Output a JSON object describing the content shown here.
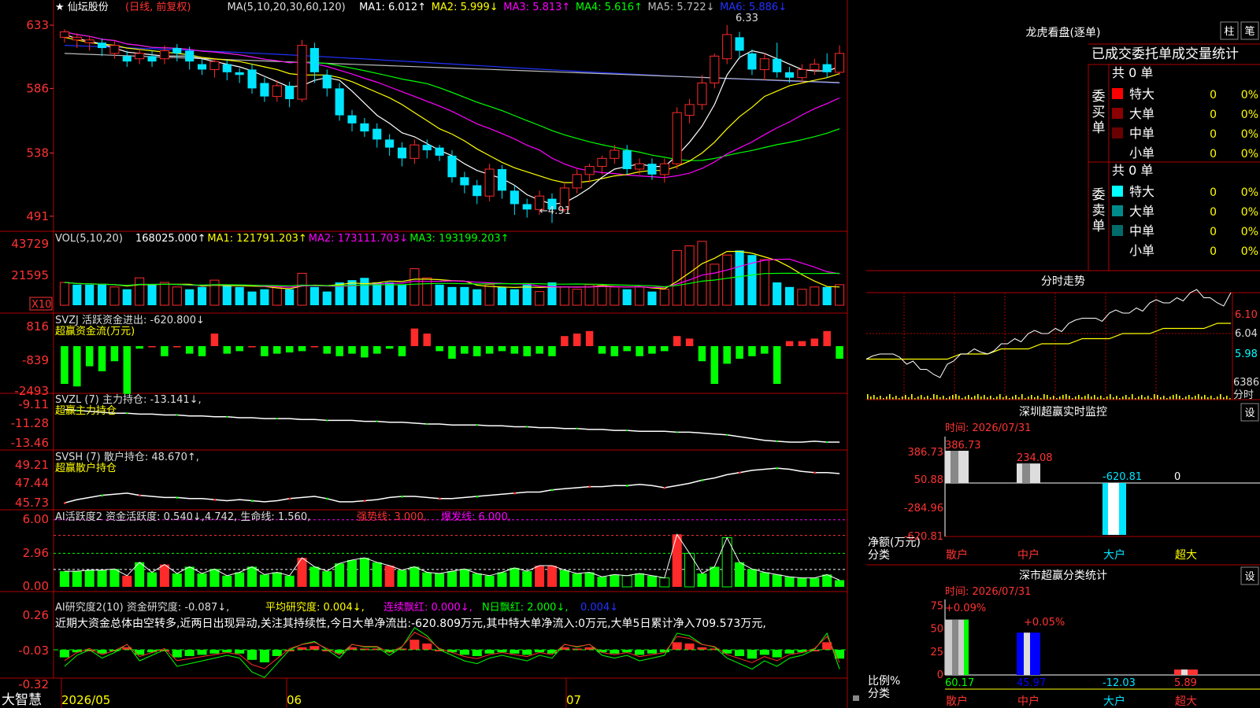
{
  "colors": {
    "up": "#ff2a2a",
    "down": "#00e5ff",
    "grid": "#b00000",
    "ma1": "#ffffff",
    "ma2": "#ffff00",
    "ma3": "#ff00ff",
    "ma4": "#00ff00",
    "ma5": "#bbbbbb",
    "ma6": "#2233ff",
    "green": "#00ff00",
    "yellow": "#ffff00",
    "magenta": "#ff00ff",
    "white": "#ffffff"
  },
  "header": {
    "title": "★ 仙坛股份",
    "mode": "(日线, 前复权)",
    "ma_name": "MA(5,10,20,30,60,120)",
    "ma1": "MA1: 6.012↑",
    "ma2": "MA2: 5.999↓",
    "ma3": "MA3: 5.813↑",
    "ma4": "MA4: 5.616↑",
    "ma5": "MA5: 5.722↓",
    "ma6": "MA6: 5.886↓"
  },
  "bottom": {
    "brand": "大智慧",
    "dates": [
      "2026/05",
      "06",
      "07"
    ]
  },
  "chart_data": [
    {
      "type": "candlestick",
      "panel": "price",
      "yticks": [
        "633",
        "586",
        "538",
        "491"
      ],
      "ylim": [
        488,
        640
      ],
      "high_label": "6.33",
      "low_label": "←4.91",
      "candles": [
        [
          624,
          628,
          620,
          630
        ],
        [
          622,
          624,
          616,
          627
        ],
        [
          620,
          622,
          614,
          625
        ],
        [
          620,
          616,
          610,
          623
        ],
        [
          612,
          618,
          608,
          621
        ],
        [
          610,
          606,
          602,
          614
        ],
        [
          608,
          612,
          604,
          615
        ],
        [
          610,
          606,
          602,
          614
        ],
        [
          608,
          614,
          604,
          618
        ],
        [
          616,
          612,
          606,
          619
        ],
        [
          614,
          606,
          600,
          617
        ],
        [
          604,
          600,
          596,
          608
        ],
        [
          600,
          606,
          594,
          608
        ],
        [
          604,
          598,
          592,
          607
        ],
        [
          598,
          596,
          590,
          601
        ],
        [
          600,
          586,
          582,
          604
        ],
        [
          590,
          580,
          576,
          594
        ],
        [
          580,
          588,
          576,
          592
        ],
        [
          588,
          578,
          572,
          591
        ],
        [
          578,
          618,
          576,
          622
        ],
        [
          616,
          598,
          590,
          620
        ],
        [
          596,
          586,
          580,
          600
        ],
        [
          586,
          566,
          562,
          590
        ],
        [
          566,
          560,
          554,
          570
        ],
        [
          560,
          554,
          550,
          564
        ],
        [
          556,
          548,
          542,
          560
        ],
        [
          548,
          542,
          536,
          552
        ],
        [
          542,
          534,
          528,
          546
        ],
        [
          534,
          544,
          530,
          548
        ],
        [
          544,
          540,
          534,
          548
        ],
        [
          542,
          536,
          532,
          544
        ],
        [
          536,
          520,
          516,
          540
        ],
        [
          520,
          514,
          508,
          524
        ],
        [
          514,
          506,
          500,
          518
        ],
        [
          506,
          526,
          502,
          530
        ],
        [
          526,
          510,
          504,
          529
        ],
        [
          510,
          500,
          492,
          514
        ],
        [
          500,
          496,
          490,
          504
        ],
        [
          496,
          506,
          492,
          510
        ],
        [
          504,
          496,
          486,
          508
        ],
        [
          496,
          512,
          494,
          516
        ],
        [
          512,
          522,
          508,
          526
        ],
        [
          522,
          528,
          516,
          530
        ],
        [
          528,
          534,
          522,
          536
        ],
        [
          534,
          540,
          530,
          544
        ],
        [
          540,
          526,
          522,
          544
        ],
        [
          526,
          530,
          522,
          534
        ],
        [
          530,
          522,
          518,
          534
        ],
        [
          522,
          530,
          516,
          534
        ],
        [
          530,
          568,
          526,
          572
        ],
        [
          566,
          574,
          560,
          578
        ],
        [
          574,
          590,
          570,
          596
        ],
        [
          590,
          610,
          586,
          612
        ],
        [
          608,
          626,
          604,
          633
        ],
        [
          624,
          614,
          608,
          628
        ],
        [
          612,
          600,
          596,
          615
        ],
        [
          600,
          608,
          592,
          612
        ],
        [
          608,
          598,
          594,
          620
        ],
        [
          598,
          594,
          590,
          602
        ],
        [
          594,
          600,
          590,
          604
        ],
        [
          600,
          604,
          596,
          608
        ],
        [
          604,
          598,
          594,
          612
        ],
        [
          598,
          612,
          596,
          618
        ]
      ],
      "ma": {
        "ma1": [
          626,
          623,
          621,
          619,
          616,
          613,
          612,
          611,
          610,
          610,
          610,
          608,
          606,
          604,
          602,
          599,
          595,
          591,
          587,
          588,
          592,
          594,
          592,
          584,
          575,
          566,
          560,
          553,
          550,
          545,
          540,
          536,
          530,
          525,
          522,
          519,
          514,
          507,
          503,
          500,
          501,
          506,
          512,
          520,
          526,
          528,
          530,
          528,
          528,
          536,
          546,
          558,
          574,
          596,
          609,
          614,
          612,
          608,
          604,
          600,
          599,
          599,
          602
        ],
        "ma2": [
          624,
          622,
          620,
          619,
          618,
          616,
          615,
          614,
          613,
          612,
          611,
          609,
          608,
          607,
          606,
          604,
          602,
          600,
          597,
          596,
          596,
          596,
          594,
          591,
          587,
          583,
          579,
          574,
          568,
          562,
          556,
          552,
          547,
          541,
          536,
          531,
          527,
          524,
          521,
          518,
          516,
          516,
          517,
          519,
          521,
          522,
          524,
          525,
          525,
          528,
          532,
          538,
          546,
          556,
          565,
          572,
          580,
          584,
          588,
          590,
          592,
          594,
          597
        ]
      }
    },
    {
      "type": "bar",
      "panel": "volume",
      "yticks": [
        "43729",
        "21595"
      ],
      "scale_label": "X10",
      "header": "VOL(5,10,20)",
      "values_text": [
        "168025.000↑",
        "MA1: 121791.203↑",
        "MA2: 173111.703↓",
        "MA3: 193199.203↑"
      ],
      "values": [
        10,
        9,
        9,
        9,
        8,
        7,
        12,
        9,
        10,
        8,
        7,
        8,
        11,
        9,
        8,
        6,
        7,
        8,
        7,
        14,
        8,
        6,
        10,
        11,
        12,
        10,
        10,
        9,
        16,
        12,
        9,
        8,
        8,
        7,
        9,
        8,
        7,
        9,
        6,
        10,
        8,
        7,
        9,
        9,
        8,
        7,
        8,
        6,
        7,
        24,
        26,
        28,
        18,
        22,
        24,
        22,
        20,
        10,
        8,
        7,
        8,
        8,
        9
      ],
      "ups": [
        1,
        0,
        0,
        0,
        1,
        0,
        1,
        0,
        1,
        1,
        0,
        0,
        1,
        0,
        0,
        0,
        0,
        1,
        0,
        1,
        0,
        0,
        0,
        0,
        0,
        0,
        0,
        0,
        1,
        1,
        0,
        0,
        0,
        0,
        1,
        0,
        0,
        0,
        1,
        0,
        1,
        1,
        1,
        1,
        1,
        0,
        1,
        0,
        1,
        1,
        1,
        1,
        1,
        1,
        0,
        0,
        1,
        0,
        0,
        1,
        1,
        0,
        1
      ]
    },
    {
      "type": "bar",
      "panel": "svzj",
      "yticks": [
        "816",
        "-839",
        "-2493"
      ],
      "header": "SVZJ  活跃资金进出: -620.800↓",
      "sub": "超赢资金流(万元)",
      "values": [
        -1500,
        -1600,
        -800,
        -1000,
        -600,
        -1900,
        -100,
        0,
        -400,
        0,
        -300,
        -400,
        500,
        -300,
        -200,
        0,
        -400,
        -300,
        -250,
        -200,
        0,
        -300,
        -400,
        -300,
        -450,
        -300,
        -100,
        -400,
        700,
        500,
        -200,
        -500,
        -300,
        -400,
        -300,
        -200,
        -300,
        -400,
        -300,
        -400,
        400,
        500,
        600,
        -300,
        -400,
        -200,
        -400,
        -300,
        -200,
        400,
        300,
        -600,
        -1500,
        -700,
        -500,
        -400,
        -300,
        -1500,
        200,
        200,
        300,
        600,
        -500
      ]
    },
    {
      "type": "line",
      "panel": "svzl",
      "yticks": [
        "-9.11",
        "-11.28",
        "-13.46"
      ],
      "header": "SVZL (7) 主力持仓: -13.141↓,",
      "sub": "超赢主力持仓",
      "values": [
        -9.6,
        -9.7,
        -9.8,
        -9.9,
        -10.0,
        -10.0,
        -10.1,
        -10.1,
        -10.2,
        -10.2,
        -10.3,
        -10.3,
        -10.4,
        -10.4,
        -10.5,
        -10.5,
        -10.6,
        -10.6,
        -10.6,
        -10.7,
        -10.7,
        -10.8,
        -10.8,
        -10.8,
        -10.9,
        -10.9,
        -11.0,
        -11.0,
        -11.1,
        -11.2,
        -11.2,
        -11.3,
        -11.3,
        -11.3,
        -11.4,
        -11.4,
        -11.5,
        -11.5,
        -11.6,
        -11.6,
        -11.7,
        -11.7,
        -11.8,
        -11.8,
        -11.9,
        -11.9,
        -12.0,
        -12.0,
        -12.0,
        -12.1,
        -12.1,
        -12.2,
        -12.3,
        -12.4,
        -12.6,
        -12.8,
        -13.0,
        -13.1,
        -13.2,
        -13.2,
        -13.1,
        -13.2,
        -13.2
      ]
    },
    {
      "type": "line",
      "panel": "svsh",
      "yticks": [
        "49.21",
        "47.44",
        "45.73"
      ],
      "header": "SVSH (7) 散户持仓: 48.670↑,",
      "sub": "超赢散户持仓",
      "values": [
        46.0,
        46.3,
        46.5,
        46.7,
        46.8,
        46.9,
        46.7,
        46.6,
        46.5,
        46.5,
        46.4,
        46.4,
        46.3,
        46.2,
        46.3,
        46.2,
        46.1,
        46.2,
        46.4,
        46.5,
        46.6,
        46.4,
        46.1,
        46.1,
        46.2,
        46.3,
        46.5,
        46.6,
        46.6,
        46.5,
        46.4,
        46.4,
        46.5,
        46.6,
        46.7,
        46.8,
        46.9,
        47.0,
        47.0,
        47.2,
        47.3,
        47.4,
        47.5,
        47.5,
        47.6,
        47.6,
        47.7,
        47.6,
        47.4,
        47.6,
        47.8,
        48.1,
        48.3,
        48.6,
        48.8,
        49.0,
        49.1,
        49.2,
        49.1,
        48.9,
        48.8,
        48.8,
        48.7
      ]
    },
    {
      "type": "bar",
      "panel": "ai_active",
      "yticks": [
        "6.00",
        "2.96",
        "0.00"
      ],
      "header": "AI活跃度2 资金活跃度: 0.540↓,4.742, 生命线: 1.560, ",
      "strong": "强势线: 3.000,",
      "burst": "爆发线: 6.000,",
      "values": [
        1.4,
        1.4,
        1.5,
        1.5,
        1.6,
        1.0,
        2.2,
        1.3,
        2.0,
        1.2,
        1.8,
        1.2,
        1.6,
        1.0,
        1.3,
        1.8,
        1.1,
        1.3,
        1.0,
        2.6,
        1.8,
        1.4,
        2.1,
        2.4,
        2.6,
        2.2,
        1.9,
        1.5,
        1.8,
        1.3,
        1.2,
        1.4,
        1.6,
        1.2,
        1.0,
        1.3,
        1.7,
        1.4,
        1.9,
        1.9,
        1.5,
        1.2,
        1.3,
        0.9,
        1.1,
        1.0,
        1.2,
        1.0,
        0.8,
        4.7,
        3.0,
        1.2,
        1.8,
        4.4,
        2.2,
        1.6,
        1.3,
        1.1,
        0.9,
        0.8,
        0.8,
        1.1,
        0.6
      ],
      "ups": [
        0,
        0,
        0,
        0,
        0,
        1,
        0,
        0,
        1,
        0,
        0,
        0,
        0,
        0,
        0,
        0,
        0,
        0,
        0,
        1,
        0,
        0,
        0,
        0,
        0,
        0,
        1,
        0,
        0,
        0,
        0,
        0,
        0,
        0,
        0,
        0,
        0,
        0,
        1,
        1,
        0,
        0,
        0,
        0,
        0,
        0,
        0,
        0,
        0,
        1,
        0,
        0,
        0,
        0,
        0,
        0,
        0,
        0,
        0,
        0,
        0,
        0,
        0
      ]
    },
    {
      "type": "bar",
      "panel": "ai_research",
      "yticks": [
        "0.26",
        "-0.03",
        "-0.32"
      ],
      "header": "AI研究度2(10) 资金研究度: -0.087↓,",
      "avg": "平均研究度: 0.004↓,",
      "lianxu": "连续飘红: 0.000↓,",
      "nday": "N日飘红: 2.000↓,",
      "val": "0.004↓",
      "note": "近期大资金总体由空转多,近两日出现异动,关注其持续性,今日大单净流出:-620.809万元,其中特大单净流入:0万元,大单5日累计净入709.573万元,",
      "values": [
        -0.06,
        -0.02,
        0.0,
        -0.03,
        -0.01,
        0.02,
        -0.04,
        -0.02,
        0.0,
        -0.06,
        -0.05,
        -0.04,
        -0.03,
        -0.02,
        -0.03,
        -0.08,
        -0.1,
        -0.05,
        0.0,
        0.02,
        0.03,
        0.0,
        -0.03,
        0.02,
        0.01,
        0.01,
        -0.02,
        0.01,
        0.08,
        0.05,
        0.0,
        -0.02,
        -0.04,
        -0.05,
        -0.03,
        -0.02,
        -0.03,
        -0.04,
        -0.02,
        -0.03,
        0.02,
        0.01,
        0.02,
        -0.02,
        -0.03,
        -0.02,
        -0.04,
        -0.03,
        -0.02,
        0.06,
        0.05,
        0.02,
        0.01,
        -0.03,
        -0.05,
        -0.07,
        -0.04,
        -0.06,
        -0.03,
        -0.02,
        0.0,
        0.06,
        -0.07
      ]
    },
    {
      "type": "bar",
      "panel": "monitor",
      "title": "深圳超赢实时监控",
      "date": "时间: 2026/07/31",
      "yticks": [
        "386.73",
        "50.88",
        "-284.96",
        "-620.81"
      ],
      "ylabel": "净额(万元)",
      "xlabel": "分类",
      "categories": [
        "散户",
        "中户",
        "大户",
        "超大"
      ],
      "values": [
        386.73,
        234.08,
        -620.81,
        0
      ],
      "labels": [
        "386.73",
        "234.08",
        "-620.81",
        "0"
      ]
    },
    {
      "type": "bar",
      "panel": "classify",
      "title": "深市超赢分类统计",
      "date": "时间: 2026/07/31",
      "yticks": [
        "75",
        "50",
        "25",
        "0"
      ],
      "ylabel": "比例%",
      "xlabel": "分类",
      "categories": [
        "散户",
        "中户",
        "大户",
        "超大"
      ],
      "values": [
        60.17,
        45.97,
        -12.03,
        5.89
      ],
      "labels": [
        "60.17",
        "45.97",
        "-12.03",
        "5.89"
      ],
      "top_labels": [
        "+0.09%",
        "+0.05%"
      ]
    },
    {
      "type": "line",
      "panel": "intraday",
      "title": "分时走势",
      "yticks": [
        "6.10",
        "6.04",
        "5.98"
      ],
      "vol_tick": "6386",
      "vol_label": "分时",
      "price": [
        5.99,
        6.0,
        6.0,
        5.98,
        5.97,
        5.96,
        5.98,
        6.0,
        6.01,
        6.0,
        6.02,
        6.03,
        6.04,
        6.04,
        6.05,
        6.06,
        6.07,
        6.07,
        6.08,
        6.08,
        6.09,
        6.1,
        6.1,
        6.11,
        6.12,
        6.11,
        6.1,
        6.12
      ],
      "avg": [
        5.99,
        5.99,
        5.99,
        5.99,
        5.99,
        5.99,
        5.99,
        6.0,
        6.0,
        6.0,
        6.01,
        6.01,
        6.01,
        6.02,
        6.02,
        6.02,
        6.03,
        6.03,
        6.03,
        6.04,
        6.04,
        6.04,
        6.05,
        6.05,
        6.05,
        6.05,
        6.06,
        6.06
      ]
    }
  ],
  "lhb": {
    "title": "龙虎看盘(逐单)",
    "btn1": "柱",
    "btn2": "笔",
    "subtitle": "已成交委托单成交量统计",
    "buy_side": "委买单",
    "sell_side": "委卖单",
    "buy_count": "共 0 单",
    "sell_count": "共 0 单",
    "buy_rows": [
      {
        "name": "特大",
        "v": "0",
        "p": "0%",
        "c": "#ff0000"
      },
      {
        "name": "大单",
        "v": "0",
        "p": "0%",
        "c": "#8b0000"
      },
      {
        "name": "中单",
        "v": "0",
        "p": "0%",
        "c": "#6b0000"
      },
      {
        "name": "小单",
        "v": "0",
        "p": "0%",
        "c": ""
      }
    ],
    "sell_rows": [
      {
        "name": "特大",
        "v": "0",
        "p": "0%",
        "c": "#00ffff"
      },
      {
        "name": "大单",
        "v": "0",
        "p": "0%",
        "c": "#008b8b"
      },
      {
        "name": "中单",
        "v": "0",
        "p": "0%",
        "c": "#006b6b"
      },
      {
        "name": "小单",
        "v": "0",
        "p": "0%",
        "c": ""
      }
    ],
    "set": "设"
  }
}
